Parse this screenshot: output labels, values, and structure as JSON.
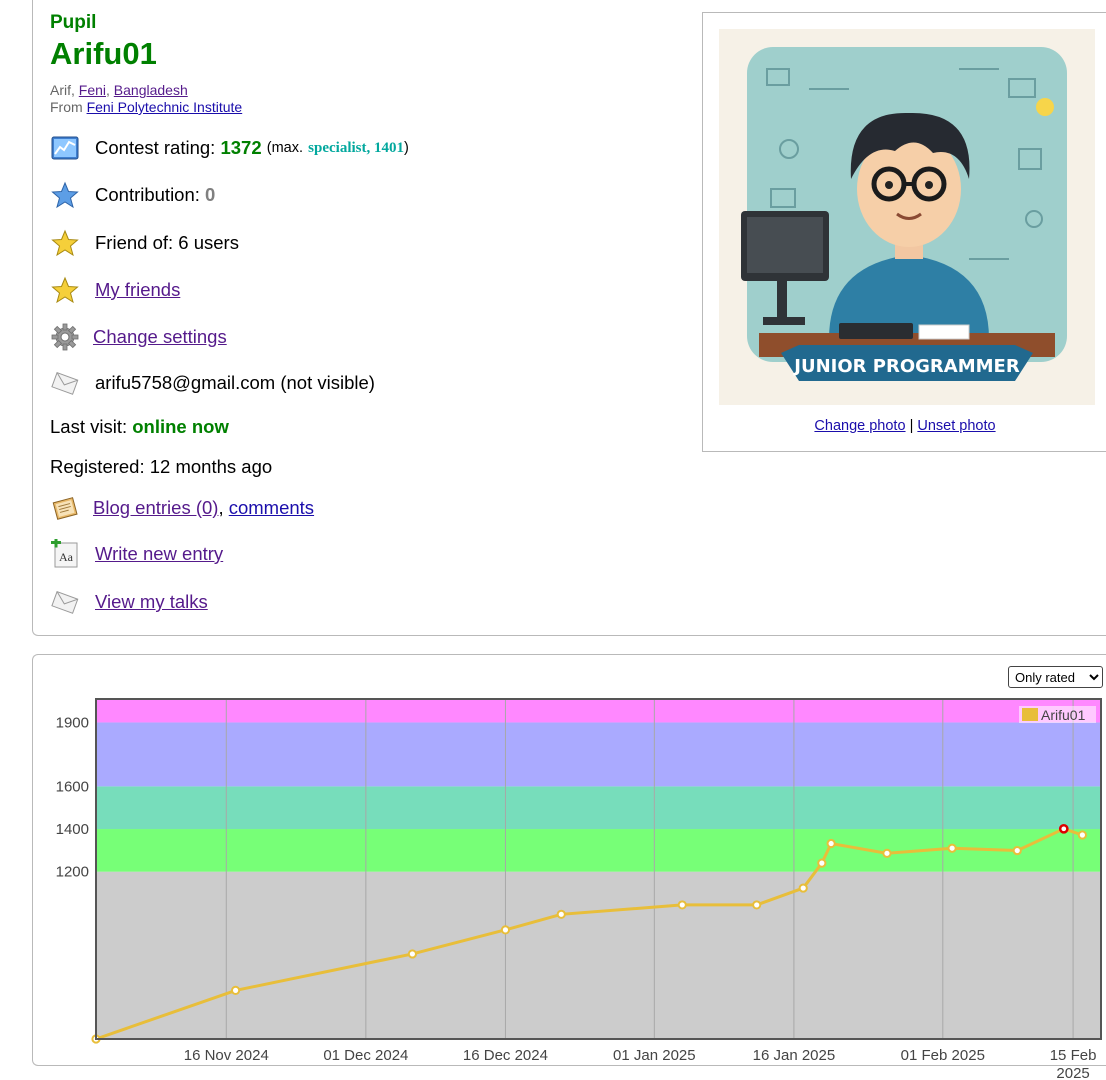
{
  "profile": {
    "rank": "Pupil",
    "handle": "Arifu01",
    "location": {
      "name": "Arif",
      "city": "Feni",
      "country": "Bangladesh",
      "from_label": "From",
      "organization": "Feni Polytechnic Institute"
    },
    "contest_rating": {
      "label": "Contest rating:",
      "value": "1372",
      "max_prefix": "(max.",
      "max_rank": "specialist, 1401",
      "max_suffix": ")"
    },
    "contribution": {
      "label": "Contribution:",
      "value": "0"
    },
    "friend_of": {
      "label": "Friend of:",
      "value": "6 users"
    },
    "my_friends": "My friends",
    "change_settings": "Change settings",
    "email": "arifu5758@gmail.com (not visible)",
    "last_visit": {
      "label": "Last visit:",
      "value": "online now"
    },
    "registered": {
      "label": "Registered:",
      "value": "12 months ago"
    },
    "blog_entries": "Blog entries (0)",
    "comments": "comments",
    "write_new_entry": "Write new entry",
    "view_my_talks": "View my talks"
  },
  "photo": {
    "banner_text": "JUNIOR PROGRAMMER",
    "change_photo": "Change photo",
    "separator": "|",
    "unset_photo": "Unset photo"
  },
  "rating_filter": {
    "selected": "Only rated"
  },
  "icons": [
    "rating-chart-icon",
    "star-blue-icon",
    "star-gold-icon",
    "star-gold-icon",
    "gear-icon",
    "envelope-icon",
    "blog-icon",
    "write-entry-icon",
    "envelope-icon"
  ],
  "chart_data": {
    "type": "line",
    "legend": "Arifu01",
    "legend_placement": "top-right",
    "series_color": "#e8be3a",
    "grid": true,
    "yticks": [
      1200,
      1400,
      1600,
      1900
    ],
    "xticks": [
      {
        "label": "16 Nov 2024",
        "date": "2024-11-16"
      },
      {
        "label": "01 Dec 2024",
        "date": "2024-12-01"
      },
      {
        "label": "16 Dec 2024",
        "date": "2024-12-16"
      },
      {
        "label": "01 Jan 2025",
        "date": "2025-01-01"
      },
      {
        "label": "16 Jan 2025",
        "date": "2025-01-16"
      },
      {
        "label": "01 Feb 2025",
        "date": "2025-02-01"
      },
      {
        "label": "15 Feb",
        "label2": "2025",
        "date": "2025-02-15"
      }
    ],
    "xlim": [
      "2024-11-02",
      "2025-02-18"
    ],
    "ylim": [
      415,
      2010
    ],
    "bands": [
      {
        "from": 0,
        "to": 1200,
        "color": "#cccccc"
      },
      {
        "from": 1200,
        "to": 1400,
        "color": "#77ff77"
      },
      {
        "from": 1400,
        "to": 1600,
        "color": "#77ddbb"
      },
      {
        "from": 1600,
        "to": 1900,
        "color": "#aaaaff"
      },
      {
        "from": 1900,
        "to": 2100,
        "color": "#ff88ff"
      }
    ],
    "points": [
      {
        "date": "2024-11-02",
        "rating": 415
      },
      {
        "date": "2024-11-17",
        "rating": 643
      },
      {
        "date": "2024-12-06",
        "rating": 814
      },
      {
        "date": "2024-12-16",
        "rating": 927
      },
      {
        "date": "2024-12-22",
        "rating": 1000
      },
      {
        "date": "2025-01-04",
        "rating": 1044
      },
      {
        "date": "2025-01-12",
        "rating": 1044
      },
      {
        "date": "2025-01-17",
        "rating": 1123
      },
      {
        "date": "2025-01-19",
        "rating": 1240
      },
      {
        "date": "2025-01-20",
        "rating": 1332
      },
      {
        "date": "2025-01-26",
        "rating": 1286
      },
      {
        "date": "2025-02-02",
        "rating": 1310
      },
      {
        "date": "2025-02-09",
        "rating": 1299
      },
      {
        "date": "2025-02-14",
        "rating": 1401,
        "max": true
      },
      {
        "date": "2025-02-16",
        "rating": 1372
      }
    ]
  }
}
